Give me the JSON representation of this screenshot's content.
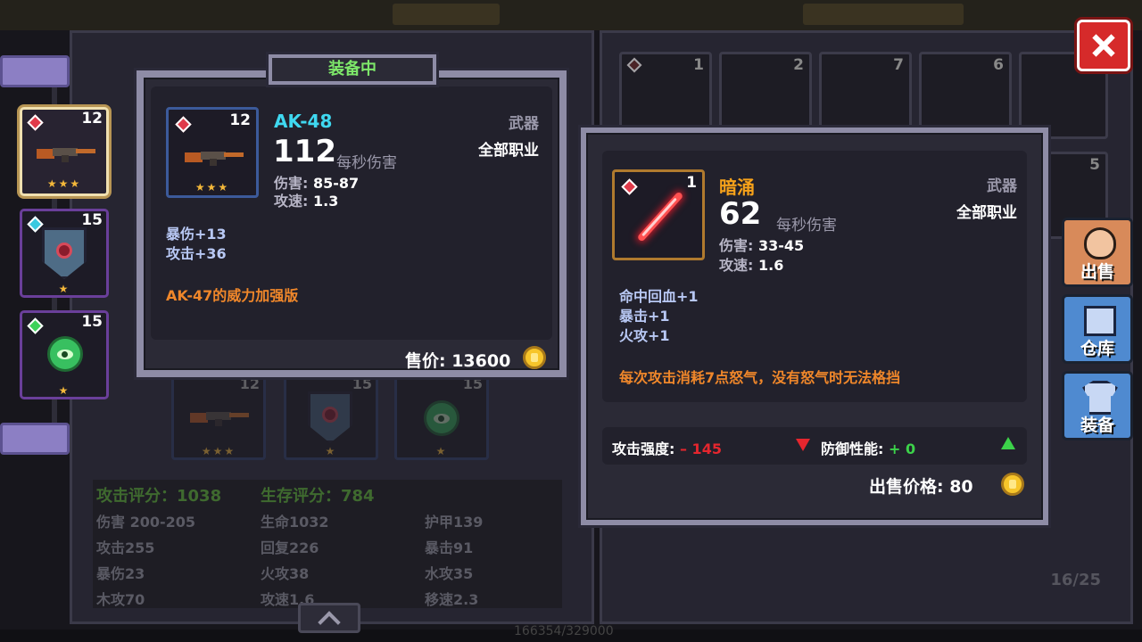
{
  "equipped_tag": "装备中",
  "bag_counts": [
    "1",
    "2",
    "7",
    "6",
    "5"
  ],
  "background_equip_counts": [
    "12",
    "15",
    "15"
  ],
  "stats": {
    "attack_score": "攻击评分：1038",
    "survive_score": "生存评分：784",
    "rows": [
      [
        "伤害 200-205",
        "生命1032",
        "护甲139"
      ],
      [
        "攻击255",
        "回复226",
        "暴击91"
      ],
      [
        "暴伤23",
        "火攻38",
        "水攻35"
      ],
      [
        "木攻70",
        "攻速1.6",
        "移速2.3"
      ]
    ]
  },
  "inventory_count": "16/25",
  "exp_text": "166354/329000",
  "equipment_slots": [
    {
      "level": "12",
      "stars": "★★★",
      "gem": "red"
    },
    {
      "level": "15",
      "stars": "★",
      "gem": "blue"
    },
    {
      "level": "15",
      "stars": "★",
      "gem": "green"
    }
  ],
  "equipped_item": {
    "name": "AK-48",
    "level": "12",
    "stars": "★★★",
    "dps": "112",
    "dps_label": "每秒伤害",
    "damage_label": "伤害:",
    "damage": "85-87",
    "speed_label": "攻速:",
    "speed": "1.3",
    "type": "武器",
    "class": "全部职业",
    "attrs": [
      "暴伤+13",
      "攻击+36"
    ],
    "description": "AK-47的威力加强版",
    "price": "售价: 13600"
  },
  "compare_item": {
    "name": "暗涌",
    "level": "1",
    "dps": "62",
    "dps_label": "每秒伤害",
    "damage_label": "伤害:",
    "damage": "33-45",
    "speed_label": "攻速:",
    "speed": "1.6",
    "type": "武器",
    "class": "全部职业",
    "attrs": [
      "命中回血+1",
      "暴击+1",
      "火攻+1"
    ],
    "description": "每次攻击消耗7点怒气，没有怒气时无法格挡",
    "attack_label": "攻击强度:",
    "attack_delta": "– 145",
    "defense_label": "防御性能:",
    "defense_delta": "+ 0",
    "sell_price": "出售价格: 80"
  },
  "side_buttons": {
    "sell": "出售",
    "warehouse": "仓库",
    "equip": "装备"
  },
  "colors": {
    "accent_green": "#7ee86a",
    "name_cyan": "#3fd8f0",
    "name_orange": "#f7a21a",
    "desc_orange": "#f0872a",
    "negative": "#e6262e",
    "positive": "#3cd24a"
  }
}
